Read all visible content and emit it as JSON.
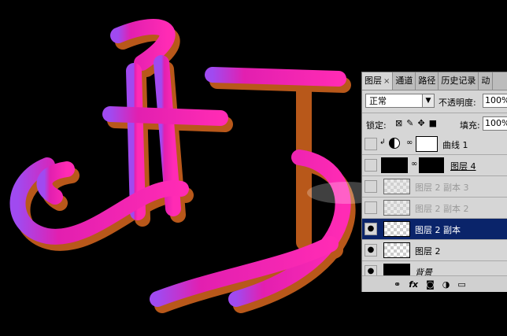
{
  "artwork": {
    "colors": {
      "background": "#000000",
      "pink": "#ff2bb4",
      "magenta": "#e01aa5",
      "violet": "#9a4ff0",
      "shadow": "#c0601a"
    }
  },
  "panel": {
    "tabs": [
      {
        "label": "图层",
        "active": true,
        "close": "×"
      },
      {
        "label": "通道"
      },
      {
        "label": "路径"
      },
      {
        "label": "历史记录"
      },
      {
        "label": "动"
      }
    ],
    "blend_mode": "正常",
    "opacity_label": "不透明度:",
    "opacity_value": "100%",
    "lock_label": "锁定:",
    "fill_label": "填充:",
    "fill_value": "100%",
    "layers": [
      {
        "name": "曲线 1",
        "visible": false
      },
      {
        "name": "图层 4",
        "visible": false
      },
      {
        "name": "图层 2 副本 3",
        "visible": false
      },
      {
        "name": "图层 2 副本 2",
        "visible": false
      },
      {
        "name": "图层 2 副本",
        "visible": true,
        "selected": true
      },
      {
        "name": "图层 2",
        "visible": true
      },
      {
        "name": "背景",
        "visible": true
      }
    ]
  }
}
